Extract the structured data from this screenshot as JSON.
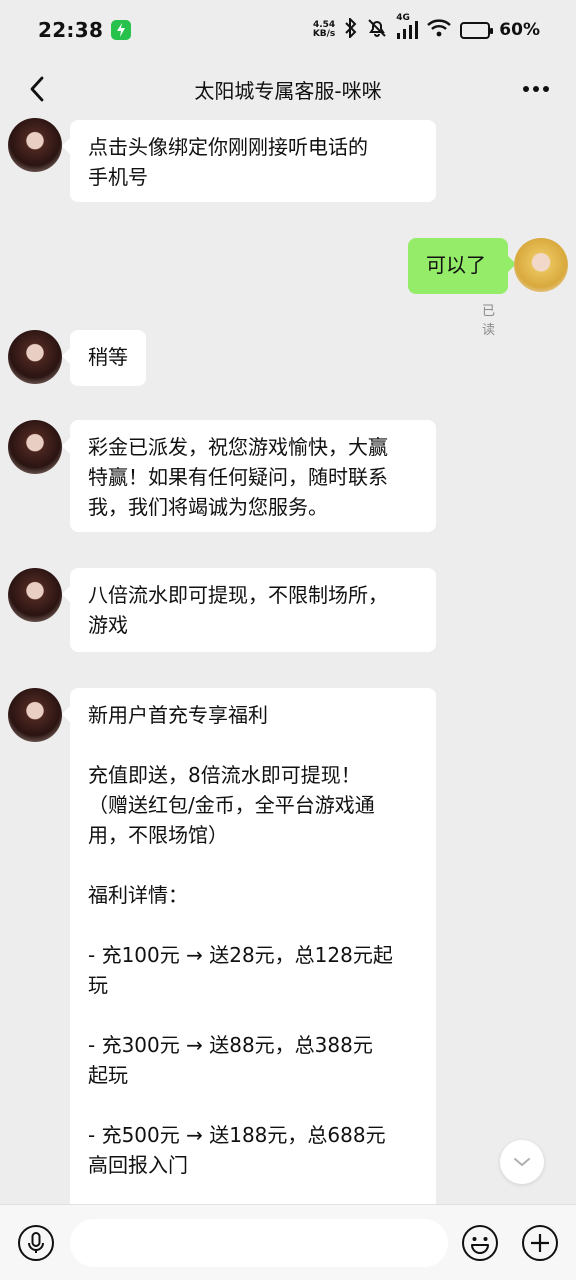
{
  "status_bar": {
    "time": "22:38",
    "net_speed_value": "4.54",
    "net_speed_unit": "KB/s",
    "signal_label": "4G",
    "battery_text": "60%",
    "battery_level": 0.6,
    "notification_color": "#27c24c"
  },
  "nav": {
    "title": "太阳城专属客服-咪咪",
    "back_icon": "chevron-left-icon",
    "more_icon": "more-horizontal-icon"
  },
  "messages": [
    {
      "side": "left",
      "text": "点击头像绑定你刚刚接听电话的\n手机号"
    },
    {
      "side": "right",
      "text": "可以了",
      "receipt": "已读"
    },
    {
      "side": "left",
      "text": "稍等"
    },
    {
      "side": "left",
      "text": "彩金已派发，祝您游戏愉快，大赢\n特赢！如果有任何疑问，随时联系\n我，我们将竭诚为您服务。"
    },
    {
      "side": "left",
      "text": "八倍流水即可提现，不限制场所，\n游戏"
    },
    {
      "side": "left",
      "text": "新用户首充专享福利\n\n充值即送，8倍流水即可提现！\n（赠送红包/金币，全平台游戏通\n用，不限场馆）\n\n福利详情：\n\n- 充100元 → 送28元，总128元起\n玩\n\n- 充300元 → 送88元，总388元\n起玩\n\n- 充500元 → 送188元，总688元\n高回报入门\n"
    }
  ],
  "input": {
    "placeholder": "",
    "voice_icon": "microphone-icon",
    "emoji_icon": "emoji-icon",
    "plus_icon": "plus-circle-icon"
  },
  "colors": {
    "background": "#ededed",
    "bubble_left": "#ffffff",
    "bubble_right": "#95ec69",
    "receipt": "#8c8c8c"
  }
}
